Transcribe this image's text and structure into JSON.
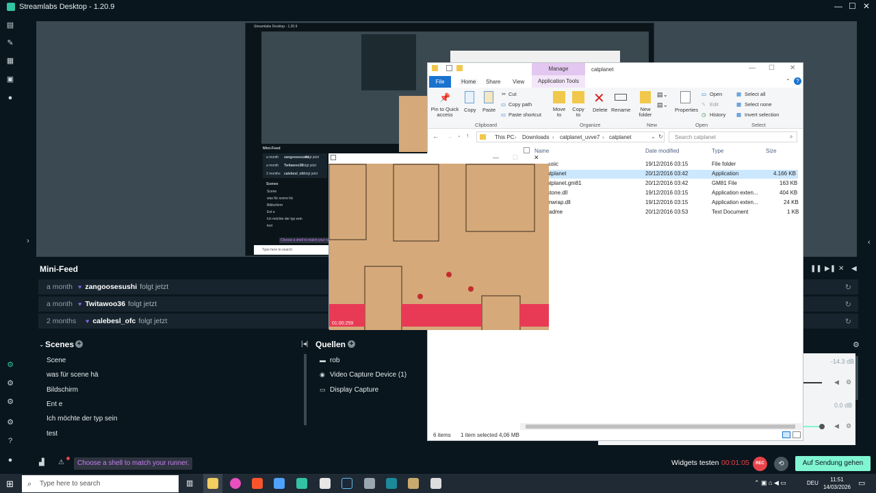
{
  "window": {
    "title": "Streamlabs Desktop - 1.20.9",
    "minimize": "—",
    "maximize": "☐",
    "close": "✕"
  },
  "nested": {
    "title": "Streamlabs Desktop - 1.20.9",
    "minifeed": "Mini-Feed",
    "rows": [
      {
        "time": "a month",
        "user": "zangoosesushi",
        "act": "folgt jetzt"
      },
      {
        "time": "a month",
        "user": "Twitawoo36",
        "act": "folgt jetzt"
      },
      {
        "time": "2 months",
        "user": "calebesl_ofc",
        "act": "folgt jetzt"
      }
    ],
    "scenes": "Scenes",
    "scene_items": [
      "Scene",
      "was für scene hä",
      "Bildschirm",
      "Ent e",
      "Ich möchte der typ sein",
      "test"
    ],
    "hint": "Choose a shell to match your runner.",
    "search": "Type here to search"
  },
  "minifeed": {
    "title": "Mini-Feed",
    "rows": [
      {
        "time": "a month",
        "user": "zangoosesushi",
        "act": "folgt jetzt"
      },
      {
        "time": "a month",
        "user": "Twitawoo36",
        "act": "folgt jetzt"
      },
      {
        "time": "2 months",
        "user": "calebesl_ofc",
        "act": "folgt jetzt"
      }
    ]
  },
  "scenes": {
    "title": "Scenes",
    "items": [
      "Scene",
      "was für scene hä",
      "Bildschirm",
      "Ent e",
      "Ich möchte der typ sein",
      "test"
    ]
  },
  "sources": {
    "title": "Quellen",
    "items": [
      "rob",
      "Video Capture Device (1)",
      "Display Capture"
    ]
  },
  "mixer": {
    "db1": "-14.3 dB",
    "db2": "0.0 dB"
  },
  "bottom": {
    "hint": "Choose a shell to match your runner.",
    "widgets": "Widgets testen",
    "timer": "00:01:05",
    "rec": "REC",
    "golive": "Auf Sendung gehen"
  },
  "explorer": {
    "title": "catplanet",
    "tabs": {
      "file": "File",
      "home": "Home",
      "share": "Share",
      "view": "View",
      "manage": "Manage",
      "apptools": "Application Tools"
    },
    "ribbon": {
      "pin": "Pin to Quick access",
      "copy": "Copy",
      "paste": "Paste",
      "cut": "Cut",
      "copypath": "Copy path",
      "pasteshortcut": "Paste shortcut",
      "clipboard": "Clipboard",
      "moveto": "Move to",
      "copyto": "Copy to",
      "delete": "Delete",
      "rename": "Rename",
      "organize": "Organize",
      "newfolder": "New folder",
      "new": "New",
      "properties": "Properties",
      "open": "Open",
      "edit": "Edit",
      "history": "History",
      "opengroup": "Open",
      "selectall": "Select all",
      "selectnone": "Select none",
      "invert": "Invert selection",
      "select": "Select"
    },
    "path": [
      "This PC",
      "Downloads",
      "catplanet_uvve7",
      "catplanet"
    ],
    "search_placeholder": "Search catplanet",
    "columns": {
      "name": "Name",
      "date": "Date modified",
      "type": "Type",
      "size": "Size"
    },
    "files": [
      {
        "name": "music",
        "date": "19/12/2016 03:15",
        "type": "File folder",
        "size": ""
      },
      {
        "name": "catplanet",
        "date": "20/12/2016 03:42",
        "type": "Application",
        "size": "4.166 KB"
      },
      {
        "name": "catplanet.gm81",
        "date": "20/12/2016 03:42",
        "type": "GM81 File",
        "size": "163 KB"
      },
      {
        "name": "ustone.dll",
        "date": "19/12/2016 03:15",
        "type": "Application exten...",
        "size": "404 KB"
      },
      {
        "name": "gmwrap.dll",
        "date": "19/12/2016 03:15",
        "type": "Application exten...",
        "size": "24 KB"
      },
      {
        "name": "readme",
        "date": "20/12/2016 03:53",
        "type": "Text Document",
        "size": "1 KB"
      }
    ],
    "status_items": "6 items",
    "status_selected": "1 item selected  4,06 MB"
  },
  "game": {
    "time": "01:00:259"
  },
  "taskbar": {
    "search": "Type here to search",
    "lang": "DEU",
    "time": "11:51",
    "date": "14/03/2026"
  },
  "colors": {
    "accent": "#80f5d2",
    "rec": "#e8434a",
    "bg": "#09161d",
    "hint": "#c77ff2"
  }
}
